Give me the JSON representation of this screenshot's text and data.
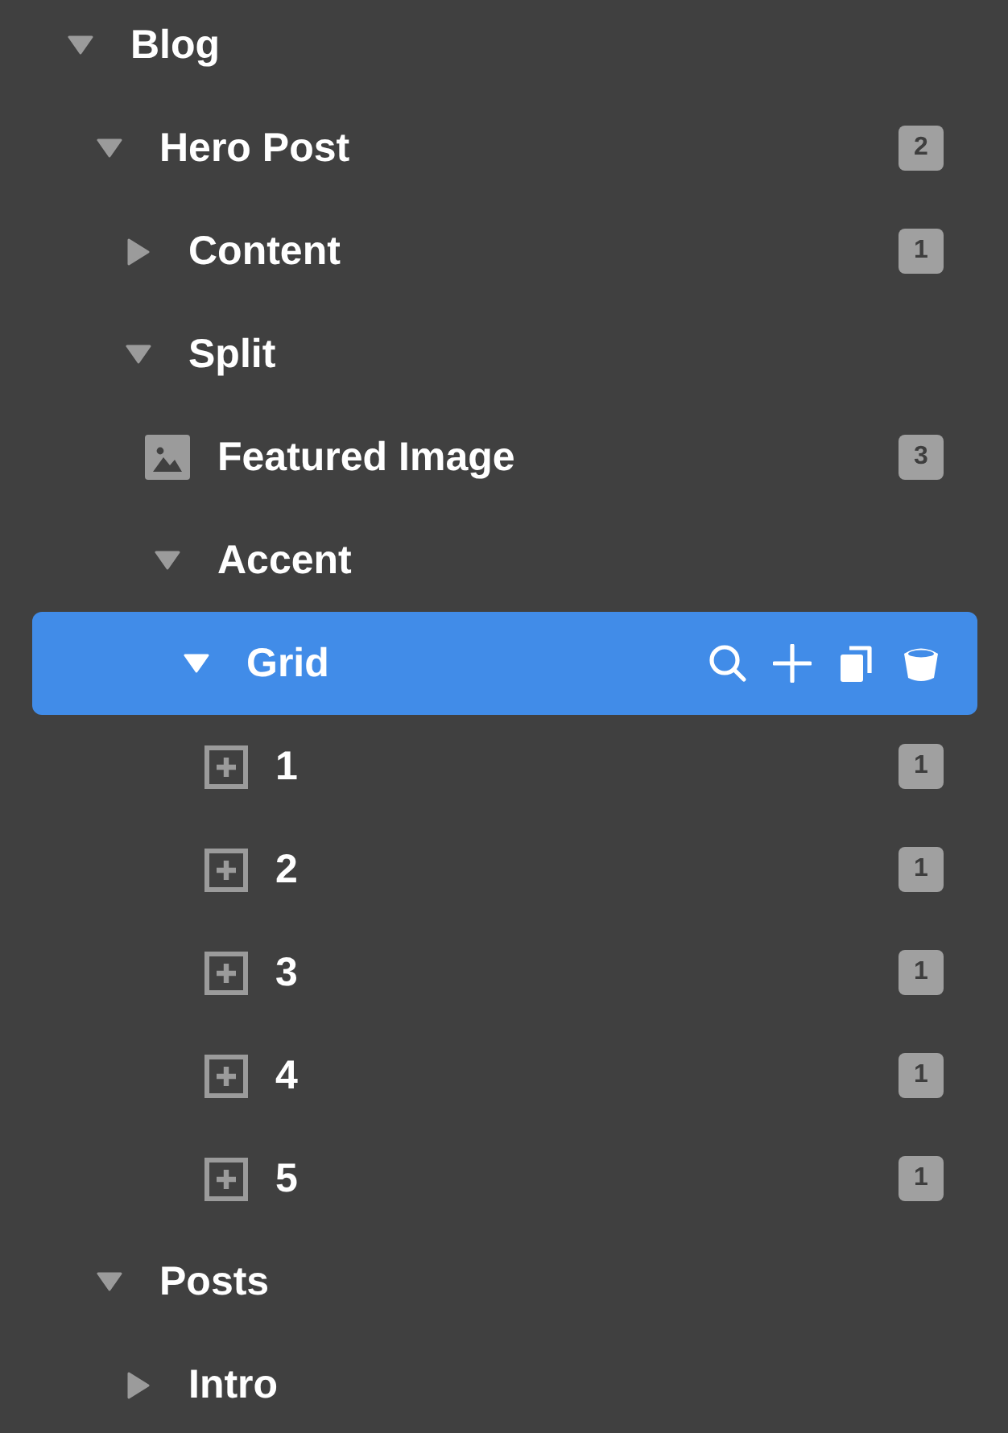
{
  "tree": [
    {
      "kind": "group",
      "label": "Blog",
      "expanded": true,
      "selected": false,
      "children": [
        {
          "kind": "group",
          "label": "Hero Post",
          "expanded": true,
          "selected": false,
          "badge": "2",
          "children": [
            {
              "kind": "group",
              "label": "Content",
              "expanded": false,
              "selected": false,
              "badge": "1"
            },
            {
              "kind": "group",
              "label": "Split",
              "expanded": true,
              "selected": false,
              "children": [
                {
                  "kind": "image",
                  "label": "Featured Image",
                  "selected": false,
                  "badge": "3"
                },
                {
                  "kind": "group",
                  "label": "Accent",
                  "expanded": true,
                  "selected": false,
                  "children": [
                    {
                      "kind": "group",
                      "label": "Grid",
                      "expanded": true,
                      "selected": true,
                      "children": [
                        {
                          "kind": "item",
                          "label": "1",
                          "selected": false,
                          "badge": "1"
                        },
                        {
                          "kind": "item",
                          "label": "2",
                          "selected": false,
                          "badge": "1"
                        },
                        {
                          "kind": "item",
                          "label": "3",
                          "selected": false,
                          "badge": "1"
                        },
                        {
                          "kind": "item",
                          "label": "4",
                          "selected": false,
                          "badge": "1"
                        },
                        {
                          "kind": "item",
                          "label": "5",
                          "selected": false,
                          "badge": "1"
                        }
                      ]
                    }
                  ]
                }
              ]
            }
          ]
        },
        {
          "kind": "group",
          "label": "Posts",
          "expanded": true,
          "selected": false,
          "children": [
            {
              "kind": "group",
              "label": "Intro",
              "expanded": false,
              "selected": false
            }
          ]
        }
      ]
    }
  ]
}
